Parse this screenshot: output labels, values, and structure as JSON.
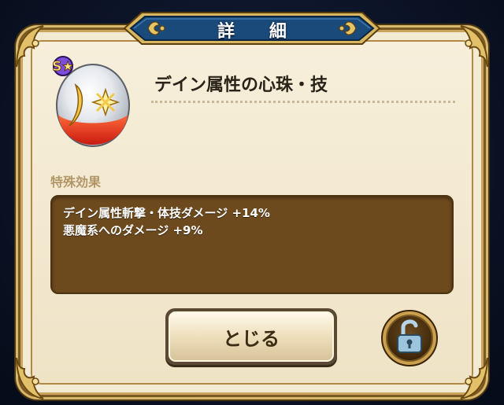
{
  "dialog": {
    "title": "詳 細",
    "item_name": "デイン属性の心珠・技",
    "rank_badge": "S★",
    "section_label": "特殊効果",
    "effects": [
      "デイン属性斬撃・体技ダメージ +14%",
      "悪魔系へのダメージ +9%"
    ],
    "close_label": "とじる",
    "gem_icon": "heart-gem-icon",
    "lock_icon": "unlocked-padlock-icon",
    "colors": {
      "panel": "#f3ead3",
      "gold_trim": "#c9a45c",
      "effects_bg": "#6c4a1e",
      "title_plate": "#1a4a7a",
      "gem_red": "#e8321e"
    }
  }
}
